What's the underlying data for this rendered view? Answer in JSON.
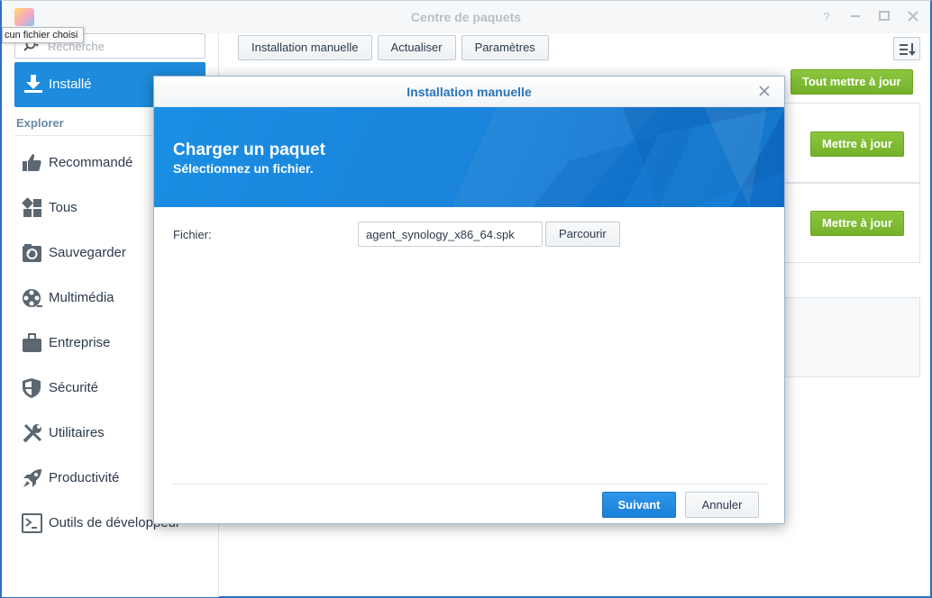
{
  "window": {
    "title": "Centre de paquets",
    "controls": [
      "help-icon",
      "pin-icon",
      "maximize-icon",
      "close-icon"
    ]
  },
  "tooltip": "cun fichier choisi",
  "sidebar": {
    "search_placeholder": "Recherche",
    "installed_label": "Installé",
    "section_label": "Explorer",
    "items": [
      {
        "label": "Recommandé",
        "icon": "thumbs-up-icon"
      },
      {
        "label": "Tous",
        "icon": "grid-icon"
      },
      {
        "label": "Sauvegarder",
        "icon": "backup-icon"
      },
      {
        "label": "Multimédia",
        "icon": "film-reel-icon"
      },
      {
        "label": "Entreprise",
        "icon": "briefcase-icon"
      },
      {
        "label": "Sécurité",
        "icon": "shield-icon"
      },
      {
        "label": "Utilitaires",
        "icon": "tools-icon"
      },
      {
        "label": "Productivité",
        "icon": "rocket-icon"
      },
      {
        "label": "Outils de développeur",
        "icon": "terminal-icon"
      }
    ]
  },
  "toolbar": {
    "manual_install_label": "Installation manuelle",
    "refresh_label": "Actualiser",
    "settings_label": "Paramètres",
    "update_all_label": "Tout mettre à jour"
  },
  "packages": [
    {
      "update_label": "Mettre à jour"
    },
    {
      "update_label": "Mettre à jour"
    }
  ],
  "dialog": {
    "title": "Installation manuelle",
    "banner_title": "Charger un paquet",
    "banner_subtitle": "Sélectionnez un fichier.",
    "file_label": "Fichier:",
    "file_value": "agent_synology_x86_64.spk",
    "browse_label": "Parcourir",
    "next_label": "Suivant",
    "cancel_label": "Annuler"
  },
  "colors": {
    "accent": "#1e8bdc",
    "update_green": "#8cc63f",
    "title_blue": "#2b74b8"
  }
}
